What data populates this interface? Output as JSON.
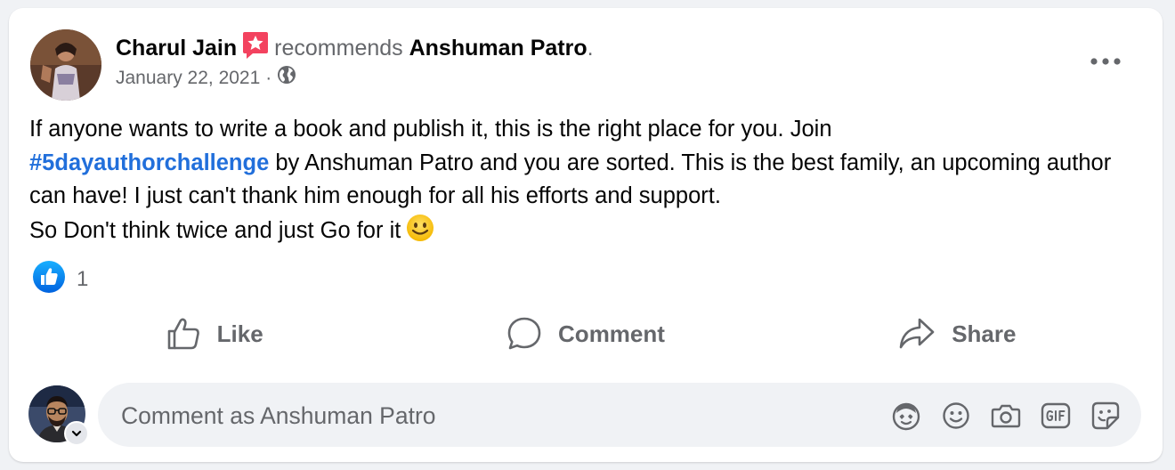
{
  "post": {
    "author": "Charul Jain",
    "verb": "recommends",
    "page": "Anshuman Patro",
    "period": ".",
    "date": "January 22, 2021",
    "separator": "·",
    "privacy_icon": "globe-icon",
    "body": {
      "line1": "If anyone wants to write a book and publish it, this is the right place for you. Join",
      "hashtag": "#5dayauthorchallenge",
      "line2": " by Anshuman Patro and you are sorted. This is the best family, an upcoming author can have! I just can't thank him enough for all his efforts and support.",
      "line3": "So Don't think twice and just Go for it"
    },
    "reactions": {
      "icon": "like-reaction-icon",
      "count": "1"
    }
  },
  "actions": {
    "like": "Like",
    "comment": "Comment",
    "share": "Share"
  },
  "composer": {
    "placeholder": "Comment as Anshuman Patro",
    "icons": [
      "avatar-sticker-icon",
      "emoji-icon",
      "camera-icon",
      "gif-icon",
      "sticker-icon"
    ]
  },
  "colors": {
    "accent": "#216fdb",
    "recommend_badge": "#f3425f",
    "like_blue": "#1877f2",
    "secondary_text": "#65676b"
  }
}
